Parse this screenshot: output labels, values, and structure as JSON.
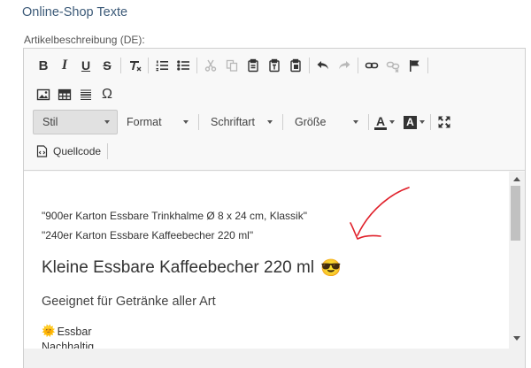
{
  "page": {
    "section_title": "Online-Shop Texte",
    "field_label": "Artikelbeschreibung (DE):"
  },
  "toolbar": {
    "bold": "B",
    "italic": "I",
    "underline": "U",
    "strike": "S",
    "special_char": "Ω",
    "combos": {
      "style": "Stil",
      "format": "Format",
      "font": "Schriftart",
      "size": "Größe"
    },
    "text_color_glyph": "A",
    "bg_color_glyph": "A",
    "source_label": "Quellcode"
  },
  "content": {
    "line1": "\"900er Karton Essbare Trinkhalme Ø 8 x 24 cm, Klassik\"",
    "line2": "\"240er Karton Essbare Kaffeebecher 220 ml\"",
    "heading": "Kleine Essbare Kaffeebecher 220 ml",
    "heading_emoji": "😎",
    "subtitle": "Geeignet für Getränke aller Art",
    "item1_icon": "🌞",
    "item1": "Essbar",
    "item2": "Nachhaltig"
  },
  "colors": {
    "section_title": "#3c5a78",
    "annotation": "#e0202a",
    "active_combo": "#e1e1e1"
  }
}
